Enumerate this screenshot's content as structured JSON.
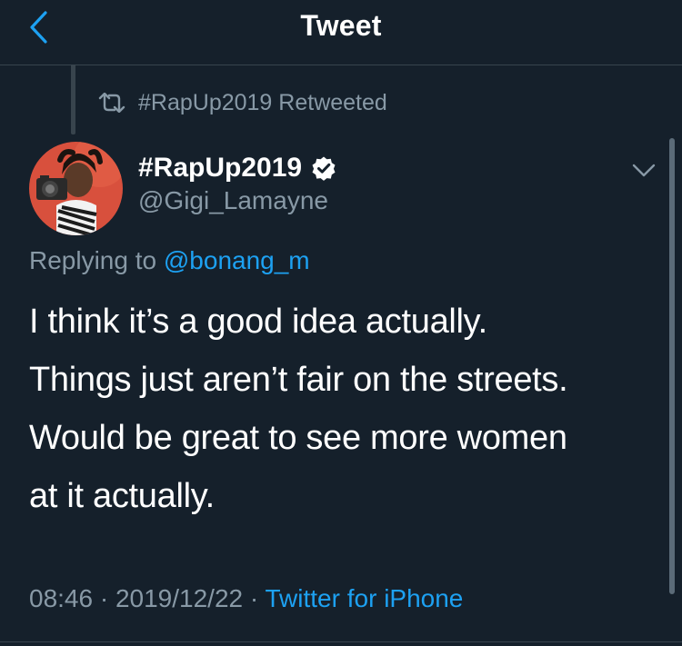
{
  "header": {
    "title": "Tweet",
    "back_icon": "chevron-left-icon"
  },
  "retweet": {
    "icon": "retweet-icon",
    "text": "#RapUp2019 Retweeted"
  },
  "author": {
    "display_name": "#RapUp2019",
    "handle": "@Gigi_Lamayne",
    "verified": true,
    "avatar_icon": "avatar"
  },
  "reply": {
    "prefix": "Replying to ",
    "mention": "@bonang_m"
  },
  "tweet": {
    "lines": [
      "I think it’s a good idea actually.",
      "Things just aren’t fair on the streets.",
      "Would be great to see more women",
      "at it actually."
    ]
  },
  "meta": {
    "time": "08:46",
    "separator": " · ",
    "date": "2019/12/22",
    "source": "Twitter for iPhone"
  },
  "colors": {
    "background": "#15202b",
    "accent": "#1da1f2",
    "secondary_text": "#8899a6",
    "divider": "#38444d"
  }
}
